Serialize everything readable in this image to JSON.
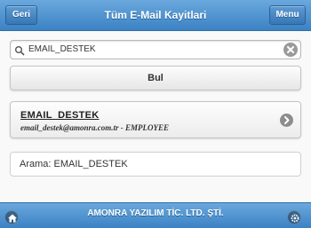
{
  "header": {
    "back_label": "Geri",
    "title": "Tüm E-Mail Kayitlari",
    "menu_label": "Menu"
  },
  "search": {
    "value": "EMAIL_DESTEK",
    "icon": "search-icon",
    "clear_icon": "clear-icon"
  },
  "find_button": {
    "label": "Bul"
  },
  "results": [
    {
      "title": "EMAIL_DESTEK",
      "subtitle": "email_destek@amonra.com.tr - EMPLOYEE",
      "icon": "chevron-right-icon"
    }
  ],
  "status": {
    "text": "Arama: EMAIL_DESTEK"
  },
  "footer": {
    "title": "AMONRA YAZILIM TİC. LTD. ŞTİ.",
    "home_icon": "home-icon",
    "settings_icon": "gear-icon"
  },
  "colors": {
    "bar_top": "#6aa8dd",
    "bar_bottom": "#3b82c4",
    "page_bg": "#f9f9f9"
  }
}
